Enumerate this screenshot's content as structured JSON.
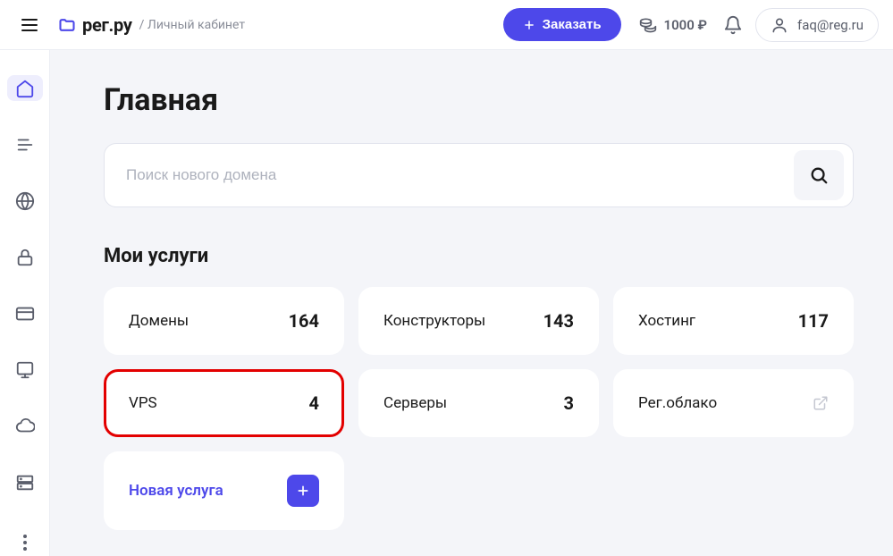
{
  "header": {
    "logo_text": "рег.ру",
    "cabinet_label": "/ Личный кабинет",
    "order_label": "Заказать",
    "balance": "1000 ₽",
    "user_email": "faq@reg.ru"
  },
  "sidebar": {
    "items": [
      "home",
      "list",
      "globe",
      "lock",
      "card",
      "server",
      "cloud",
      "storage",
      "more"
    ]
  },
  "main": {
    "page_title": "Главная",
    "search_placeholder": "Поиск нового домена",
    "section_title": "Мои услуги",
    "services": [
      {
        "label": "Домены",
        "count": "164",
        "highlight": false,
        "type": "count"
      },
      {
        "label": "Конструкторы",
        "count": "143",
        "highlight": false,
        "type": "count"
      },
      {
        "label": "Хостинг",
        "count": "117",
        "highlight": false,
        "type": "count"
      },
      {
        "label": "VPS",
        "count": "4",
        "highlight": true,
        "type": "count"
      },
      {
        "label": "Серверы",
        "count": "3",
        "highlight": false,
        "type": "count"
      },
      {
        "label": "Рег.облако",
        "count": "",
        "highlight": false,
        "type": "external"
      },
      {
        "label": "Новая услуга",
        "count": "",
        "highlight": false,
        "type": "new"
      }
    ]
  }
}
